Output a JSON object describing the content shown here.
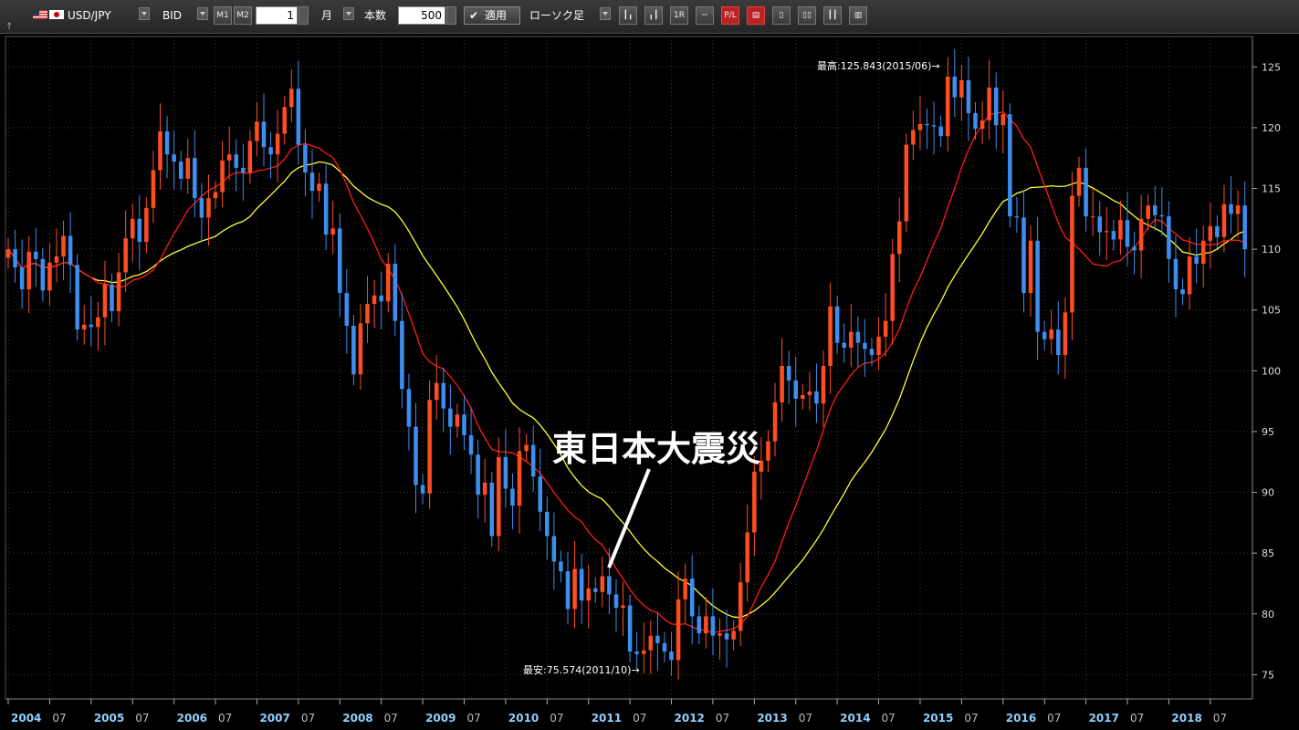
{
  "toolbar": {
    "symbol": "USD/JPY",
    "price_type": "BID",
    "m1_label": "M1",
    "m2_label": "M2",
    "period_value": "1",
    "period_unit": "月",
    "bar_count_label": "本数",
    "bar_count_value": "500",
    "apply_label": "適用",
    "chart_type": "ローソク足",
    "tool_icons": [
      "candle-icon",
      "candle-alt-icon",
      "1r-icon",
      "line-icon",
      "pl-icon",
      "pl-alt-icon",
      "bars-icon",
      "bars-alt-icon",
      "bars-3-icon",
      "bars-4-icon"
    ]
  },
  "chart_data": {
    "type": "candlestick",
    "title": "",
    "ylim": [
      73,
      127.5
    ],
    "y_ticks": [
      75,
      80,
      85,
      90,
      95,
      100,
      105,
      110,
      115,
      120,
      125
    ],
    "x_labels": [
      "2004",
      "07",
      "2005",
      "07",
      "2006",
      "07",
      "2007",
      "07",
      "2008",
      "07",
      "2009",
      "07",
      "2010",
      "07",
      "2011",
      "07",
      "2012",
      "07",
      "2013",
      "07",
      "2014",
      "07",
      "2015",
      "07",
      "2016",
      "07",
      "2017",
      "07",
      "2018",
      "07"
    ],
    "start": "2004-01",
    "bullish_color": "#ff4d22",
    "bearish_color": "#3d8ef0",
    "ma_short_color": "#ff1a1a",
    "ma_long_color": "#ffff33",
    "high_annotation": "最高:125.843(2015/06)→",
    "low_annotation": "最安:75.574(2011/10)→",
    "event_label": "東日本大震災",
    "closes": [
      110,
      108.5,
      106.7,
      109.8,
      109.2,
      106.6,
      108.9,
      109.4,
      111.1,
      108.7,
      103.4,
      103.8,
      103.6,
      104.4,
      107.1,
      104.9,
      108.1,
      110.9,
      112.5,
      110.6,
      113.4,
      116.5,
      119.7,
      117.8,
      117.2,
      115.8,
      117.5,
      114.2,
      112.6,
      114.2,
      114.7,
      117.3,
      117.8,
      116.7,
      116.3,
      118.9,
      120.5,
      118.4,
      117.8,
      119.5,
      121.7,
      123.2,
      118.6,
      116.3,
      114.8,
      115.4,
      111.2,
      111.7,
      106.4,
      103.7,
      99.7,
      103.9,
      105.5,
      106.2,
      105.7,
      108.8,
      104.1,
      98.5,
      95.4,
      90.6,
      89.9,
      97.6,
      99,
      96.9,
      95.4,
      96.4,
      94.7,
      93.1,
      89.8,
      90.8,
      86.4,
      92.9,
      90.3,
      88.9,
      93.4,
      93.9,
      91.3,
      88.4,
      86.4,
      84.3,
      83.5,
      80.4,
      83.7,
      81.1,
      82.1,
      81.8,
      83.1,
      81.6,
      80.5,
      80.7,
      76.9,
      76.7,
      77,
      78.2,
      77.6,
      76.9,
      76.2,
      81.2,
      82.9,
      79.8,
      78.4,
      79.8,
      78.2,
      78.4,
      77.9,
      78.6,
      82.6,
      86.7,
      91.7,
      92.6,
      94.2,
      97.4,
      100.4,
      99.2,
      97.7,
      98,
      98.3,
      97.3,
      100.4,
      105.3,
      102.3,
      101.9,
      103.2,
      102.3,
      101.8,
      101.3,
      102.8,
      104.1,
      109.6,
      112.3,
      118.6,
      119.8,
      120.3,
      120.2,
      120.1,
      119.3,
      124.2,
      122.5,
      123.9,
      121.2,
      119.9,
      120.6,
      123.3,
      120.2,
      121.1,
      112.7,
      112.6,
      106.4,
      110.7,
      103.2,
      102.6,
      103.4,
      101.3,
      104.8,
      114.4,
      116.7,
      112.7,
      112.7,
      111.4,
      111.5,
      110.8,
      112.4,
      110.2,
      109.9,
      112.5,
      113.6,
      112.8,
      112.7,
      109.2,
      106.7,
      106.3,
      109.4,
      108.8,
      110.7,
      111.9,
      111,
      113.7,
      112.9,
      113.6,
      110
    ]
  }
}
